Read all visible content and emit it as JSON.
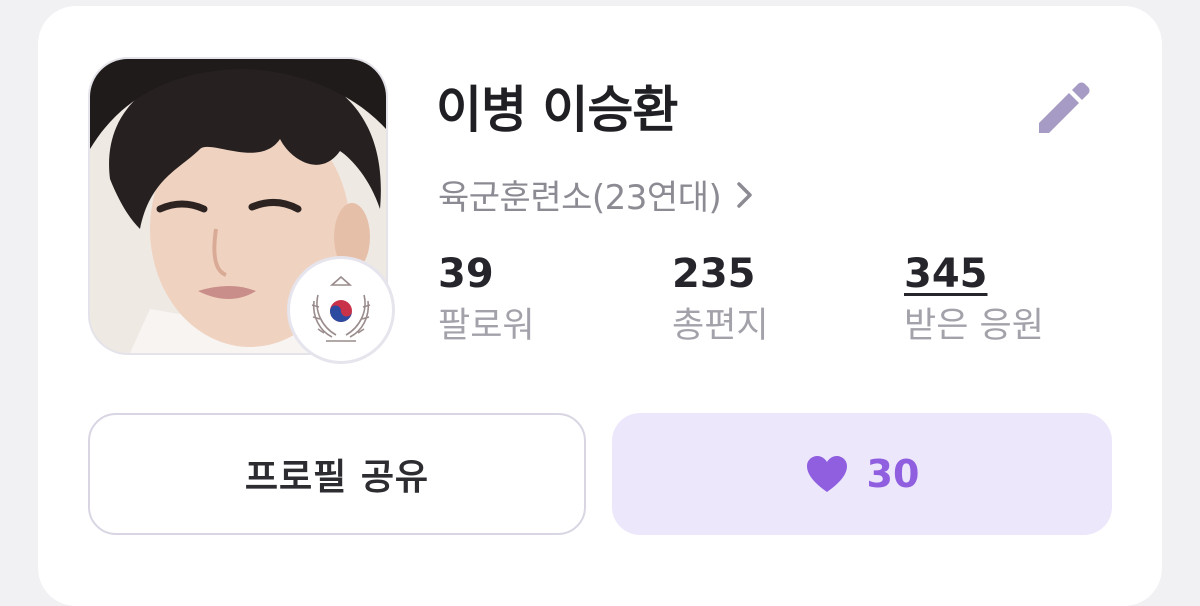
{
  "profile": {
    "name": "이병 이승환",
    "unit": "육군훈련소(23연대)"
  },
  "stats": [
    {
      "value": "39",
      "label": "팔로워"
    },
    {
      "value": "235",
      "label": "총편지"
    },
    {
      "value": "345",
      "label": "받은 응원"
    }
  ],
  "actions": {
    "share_label": "프로필 공유",
    "like_count": "30"
  },
  "icons": {
    "edit": "pencil-icon",
    "unit_arrow": "chevron-right-icon",
    "like": "heart-icon",
    "emblem": "army-emblem-icon"
  },
  "colors": {
    "accent": "#8f5fe0",
    "like_bg": "#ede7fb",
    "edit_icon": "#a69bc4",
    "muted_text": "#8c8b93"
  }
}
